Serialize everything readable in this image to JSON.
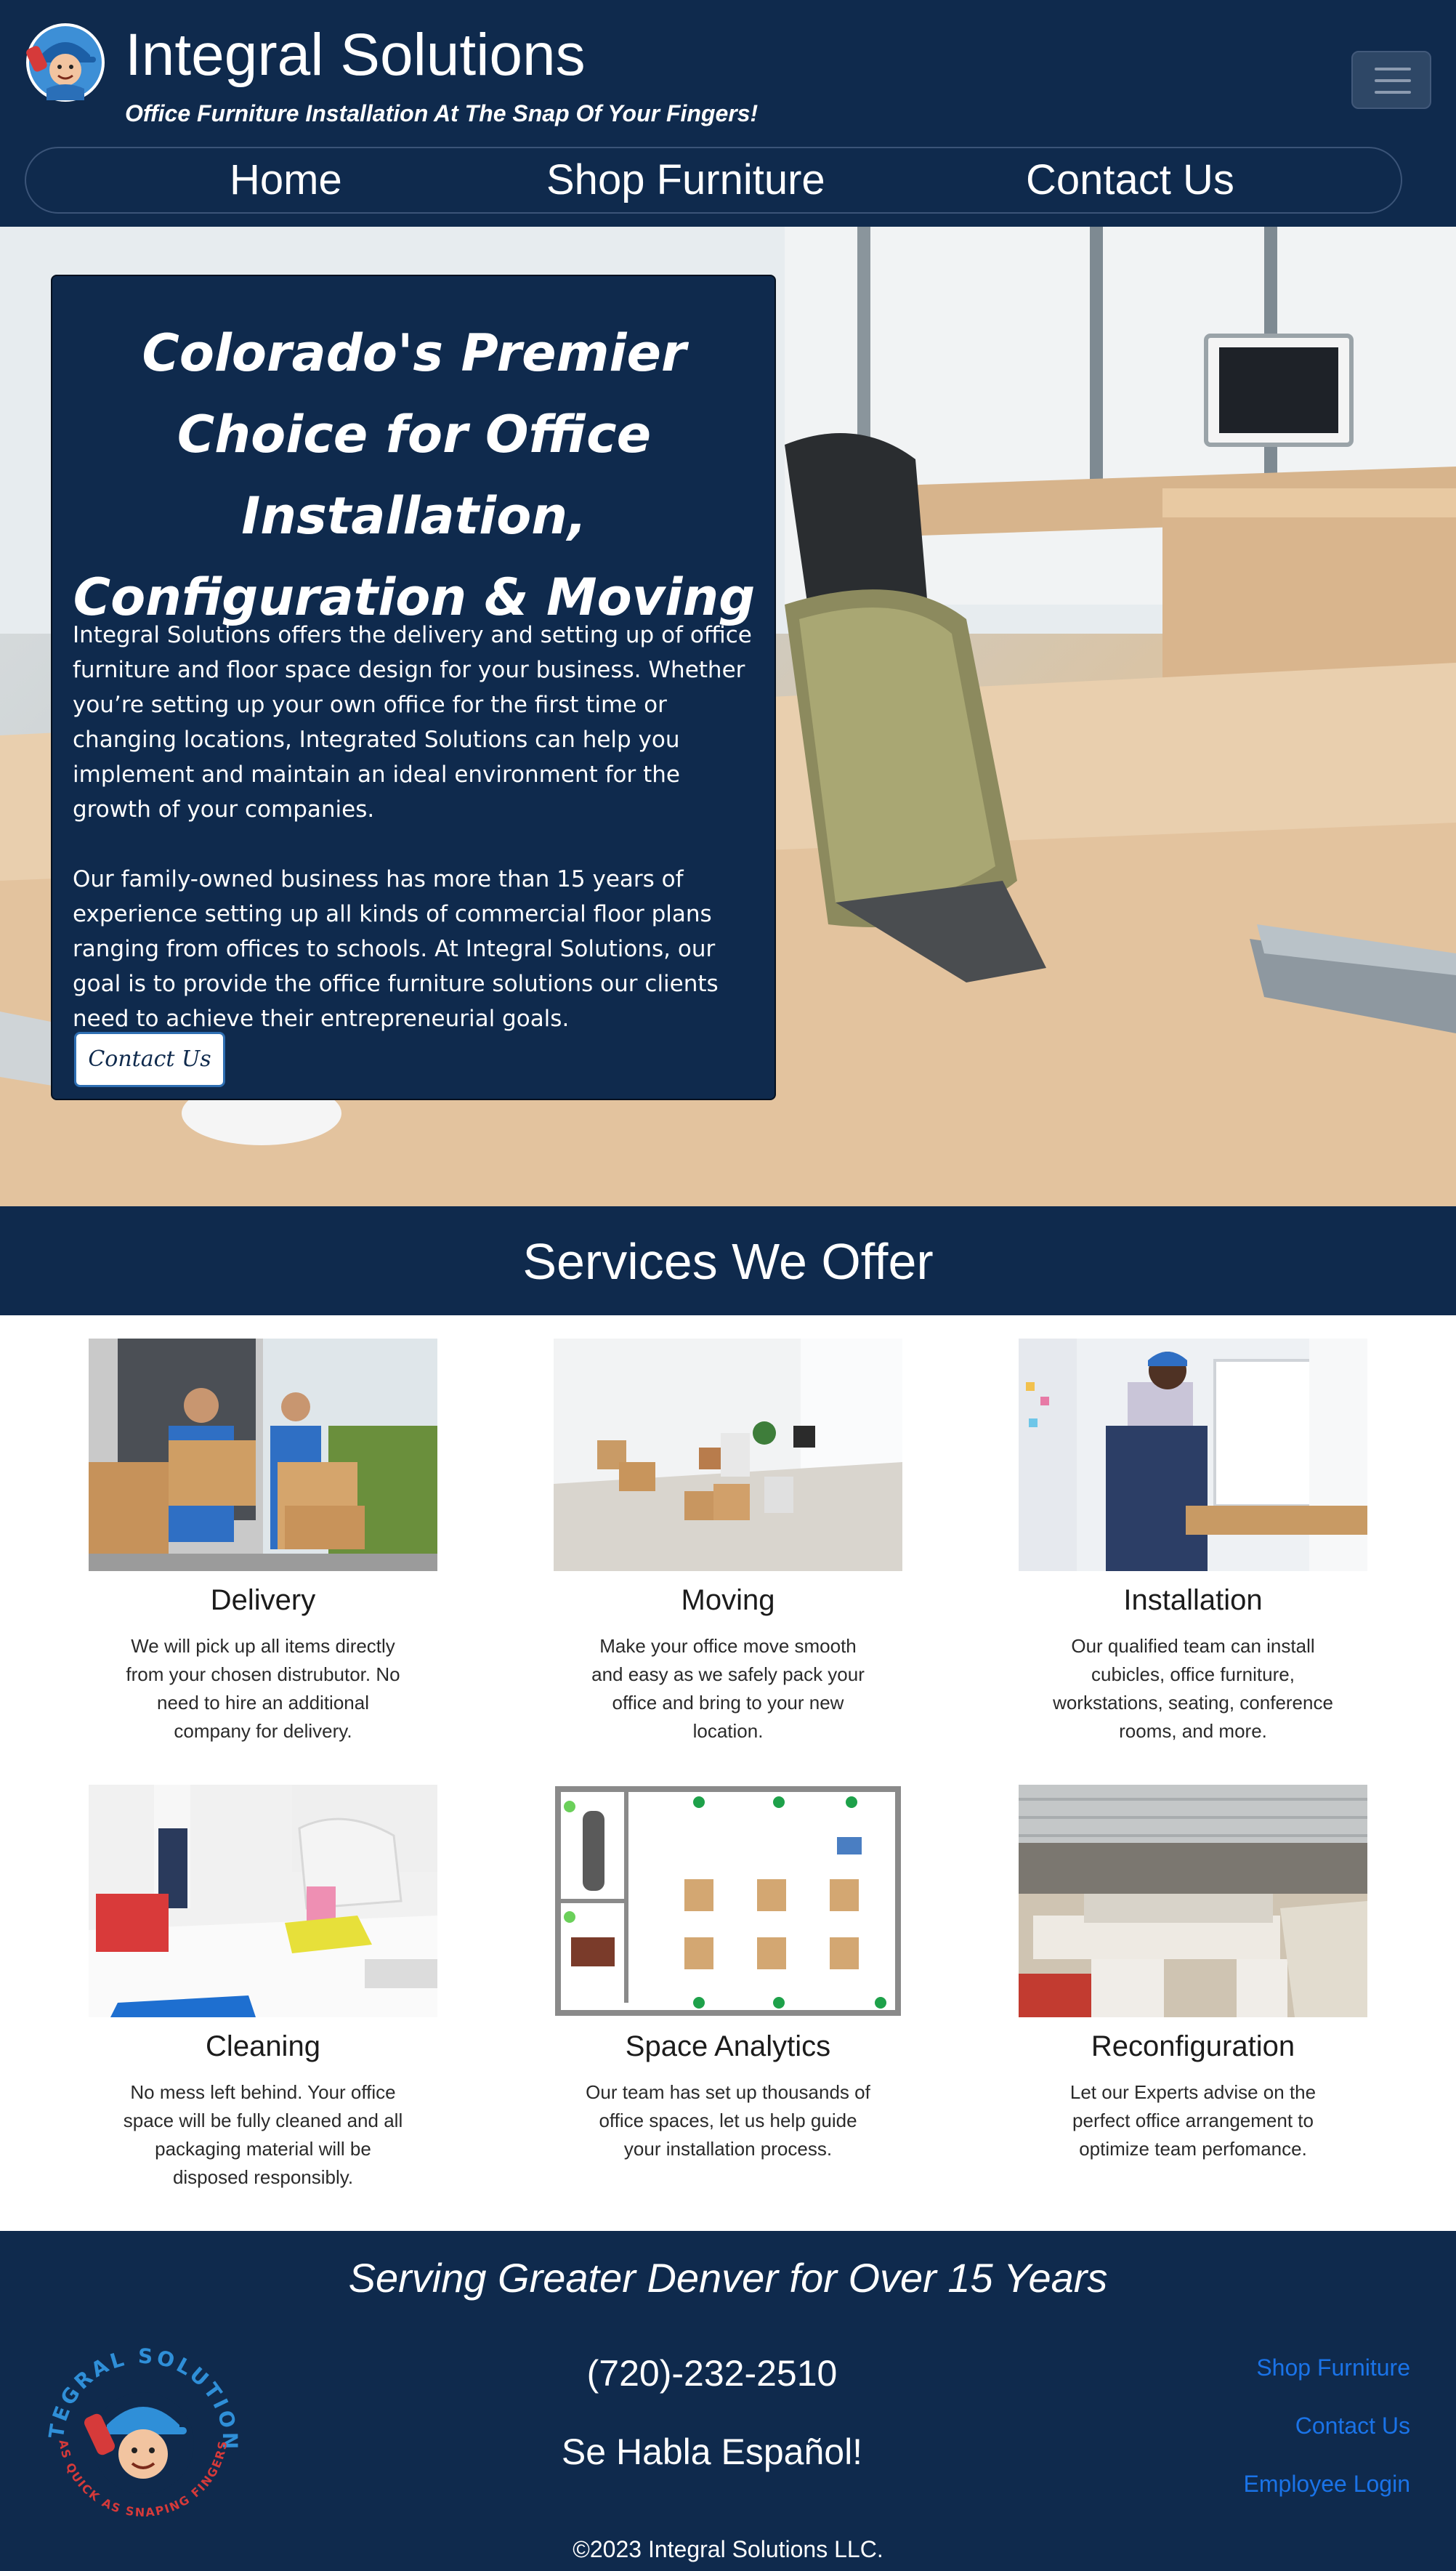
{
  "header": {
    "title": "Integral Solutions",
    "tagline": "Office Furniture Installation At The Snap Of Your Fingers!",
    "menu_icon": "hamburger-icon"
  },
  "nav": {
    "items": [
      {
        "label": "Home"
      },
      {
        "label": "Shop Furniture"
      },
      {
        "label": "Contact Us"
      }
    ]
  },
  "hero": {
    "title": "Colorado's Premier Choice for Office Installation, Configuration & Moving",
    "paragraph1": "Integral Solutions offers the delivery and setting up of office furniture and floor space design for your business. Whether you’re setting up your own office for the first time or changing locations, Integrated Solutions can help you implement and maintain an ideal environment for the growth of your companies.",
    "paragraph2": "Our family-owned business has more than 15 years of experience setting up all kinds of commercial floor plans ranging from offices to schools. At Integral Solutions, our goal is to provide the office furniture solutions our clients need to achieve their entrepreneurial goals.",
    "button_label": "Contact Us"
  },
  "services": {
    "title": "Services We Offer",
    "items": [
      {
        "name": "Delivery",
        "description": "We will pick up all items directly from your chosen distrubutor. No need to hire an additional company for delivery."
      },
      {
        "name": "Moving",
        "description": "Make your office move smooth and easy as we safely pack your office and bring to your new location."
      },
      {
        "name": "Installation",
        "description": "Our qualified team can install cubicles, office furniture, workstations, seating, conference rooms, and more."
      },
      {
        "name": "Cleaning",
        "description": "No mess left behind. Your office space will be fully cleaned and all packaging material will be disposed responsibly."
      },
      {
        "name": "Space Analytics",
        "description": "Our team has set up thousands of office spaces, let us help guide your installation process."
      },
      {
        "name": "Reconfiguration",
        "description": "Let our Experts advise on the perfect office arrangement to optimize team perfomance."
      }
    ]
  },
  "footer": {
    "title": "Serving Greater Denver for Over 15 Years",
    "phone": "(720)-232-2510",
    "spanish": "Se Habla Español!",
    "copyright": "©2023 Integral Solutions LLC.",
    "logo_text_top": "INTEGRAL SOLUTIONS",
    "logo_text_bottom": "AS QUICK AS SNAPING FINGERS",
    "links": [
      {
        "label": "Shop Furniture"
      },
      {
        "label": "Contact Us"
      },
      {
        "label": "Employee Login"
      }
    ]
  },
  "colors": {
    "navy": "#0f2a4d",
    "link_blue": "#1a73e8",
    "logo_blue": "#2f8fd8",
    "logo_red": "#d63a3a"
  }
}
